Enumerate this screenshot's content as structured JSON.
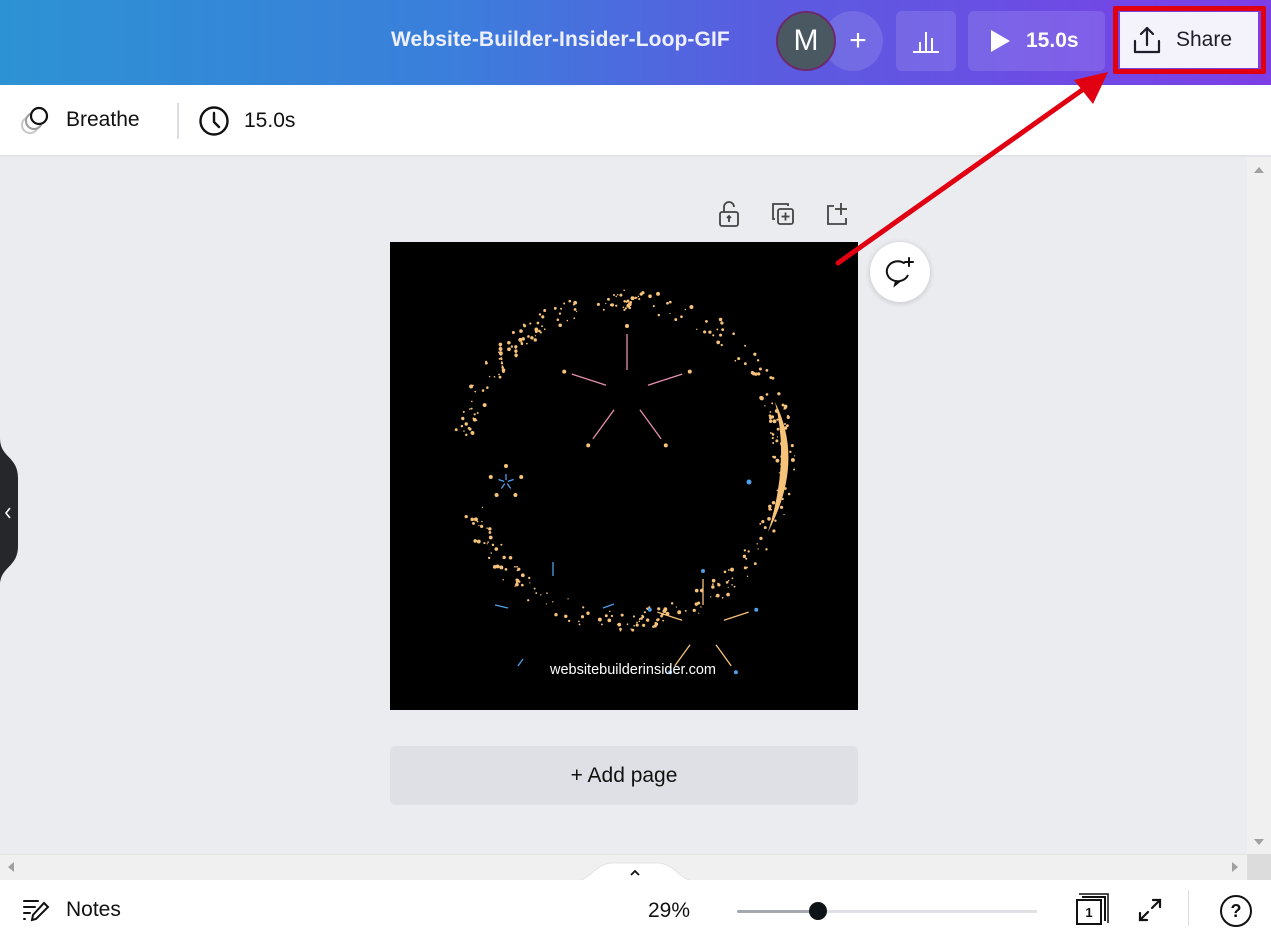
{
  "header": {
    "doc_title": "Website-Builder-Insider-Loop-GIF",
    "avatar_initial": "M",
    "add_collaborator_symbol": "+",
    "insights_icon": "bar-chart-icon",
    "play_duration": "15.0s",
    "share_label": "Share",
    "share_icon": "upload-icon"
  },
  "toolbar": {
    "animation_label": "Breathe",
    "animation_icon": "animation-circles-icon",
    "duration_label": "15.0s",
    "duration_icon": "clock-icon"
  },
  "canvas": {
    "page_tools": [
      "lock-icon",
      "duplicate-page-icon",
      "add-page-icon"
    ],
    "design_text": "websitebuilderinsider.com",
    "comment_icon": "add-comment-icon",
    "add_page_label": "+ Add page",
    "colors": {
      "sparkle": "#f7c27a",
      "pink_star": "#e58fb0",
      "blue_accent": "#4f9fe8"
    }
  },
  "footer": {
    "notes_label": "Notes",
    "zoom_percent": "29%",
    "zoom_slider_fraction": 0.27,
    "page_count": "1",
    "help_symbol": "?"
  },
  "annotation": {
    "highlight_color": "#e00012",
    "target": "share-button"
  }
}
